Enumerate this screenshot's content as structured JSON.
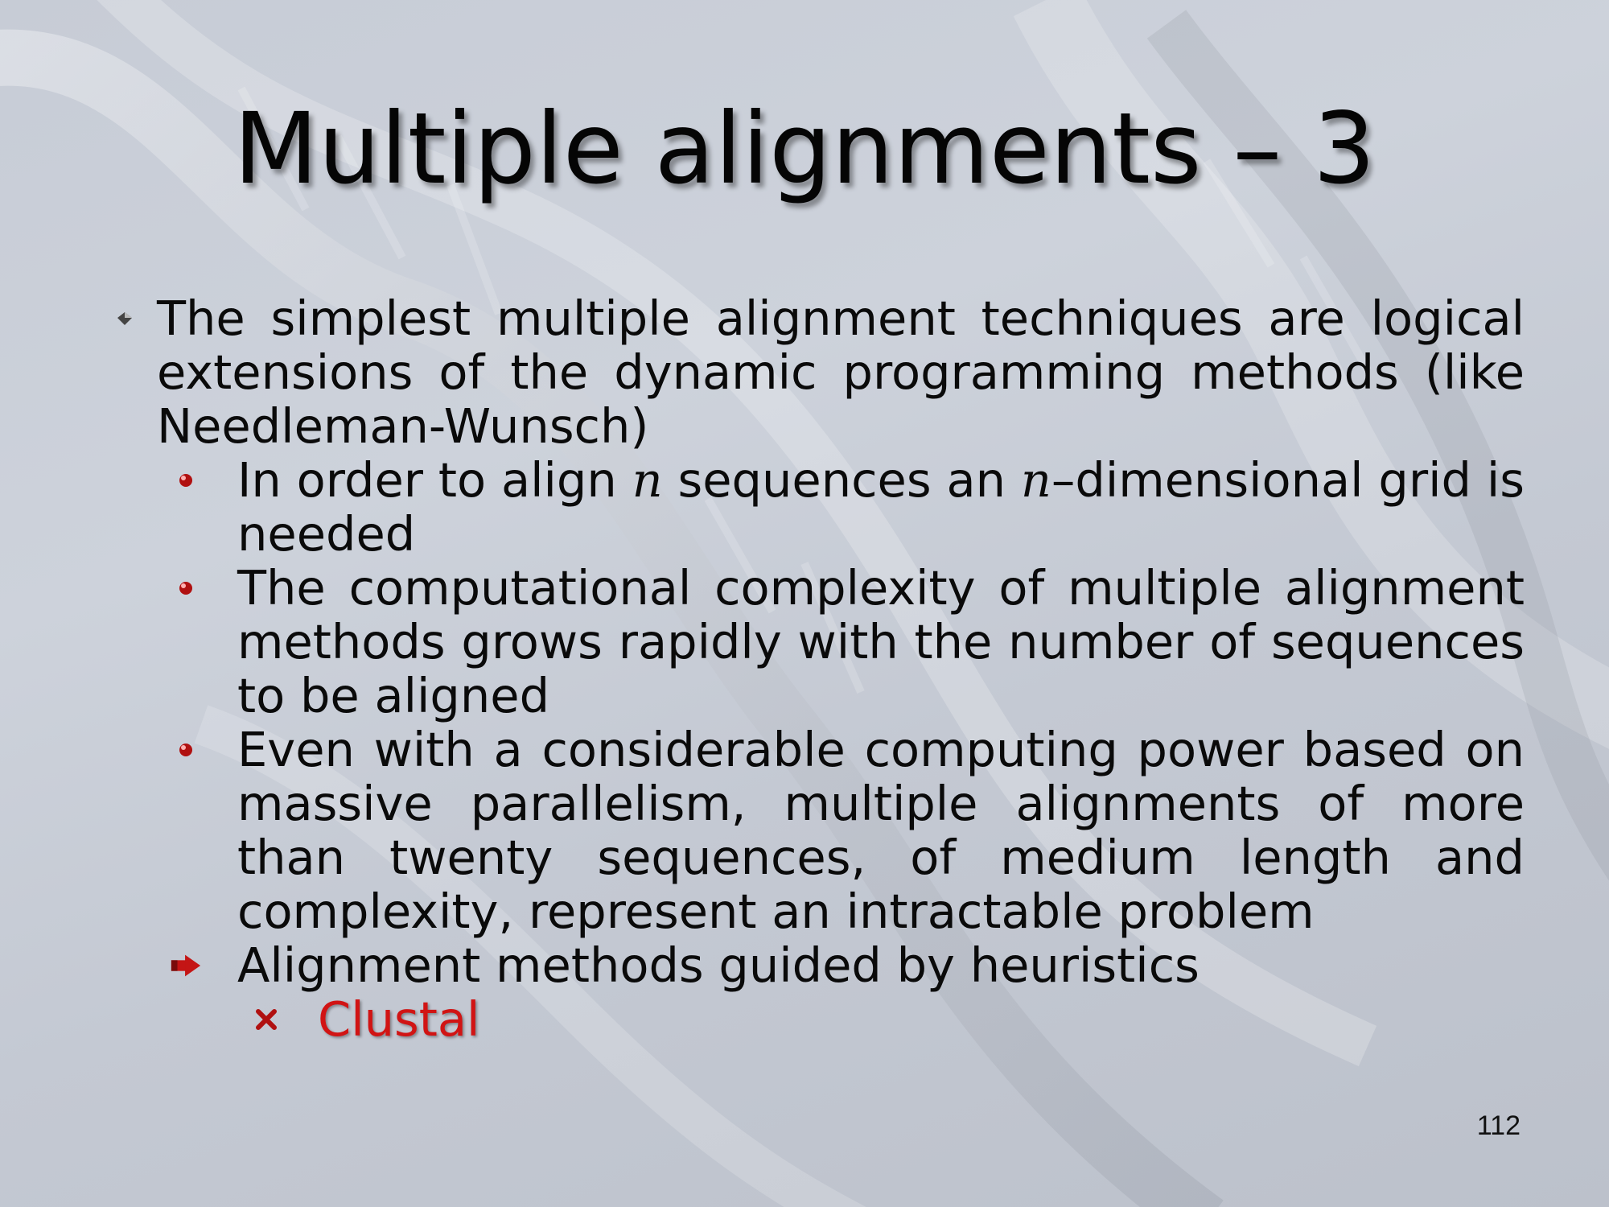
{
  "slide": {
    "title": "Multiple alignments – 3",
    "page_number": "112"
  },
  "bullets": [
    {
      "level": 1,
      "icon": "diamond-bullet-icon",
      "text": "The simplest multiple alignment techniques are logical extensions of the dynamic programming methods (like Needleman-Wunsch)"
    },
    {
      "level": 2,
      "icon": "red-ball-bullet-icon",
      "parts": [
        "In order to align ",
        "n",
        " sequences an ",
        "n",
        "–dimensional grid is needed"
      ]
    },
    {
      "level": 2,
      "icon": "red-ball-bullet-icon",
      "text": "The computational complexity of multiple alignment methods grows rapidly with the number of sequences to be aligned"
    },
    {
      "level": 2,
      "icon": "red-ball-bullet-icon",
      "text": "Even with a considerable computing power based on massive parallelism, multiple alignments of more than twenty sequences, of medium length and complexity, represent an intractable problem"
    },
    {
      "level": 2,
      "icon": "red-arrow-bullet-icon",
      "text": "Alignment methods guided by heuristics"
    },
    {
      "level": 3,
      "icon": "red-x-bullet-icon",
      "text": "Clustal"
    }
  ],
  "colors": {
    "background": "#c9ced8",
    "text": "#0a0a0a",
    "accent_red": "#d11414"
  }
}
